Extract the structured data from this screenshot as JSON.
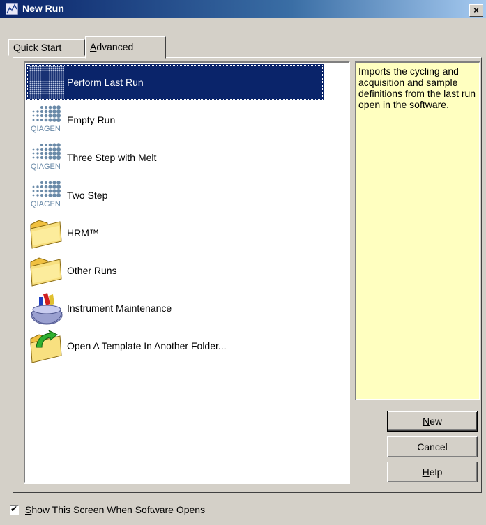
{
  "window": {
    "title": "New Run",
    "close_glyph": "×"
  },
  "tabs": [
    {
      "label": "Quick Start",
      "mnemonic": "Q",
      "rest": "uick Start",
      "active": false
    },
    {
      "label": "Advanced",
      "mnemonic": "A",
      "rest": "dvanced",
      "active": true
    }
  ],
  "list": {
    "items": [
      {
        "label": "Perform Last Run",
        "icon": "qiagen-dots-icon",
        "selected": true
      },
      {
        "label": "Empty Run",
        "icon": "qiagen-logo-icon",
        "selected": false
      },
      {
        "label": "Three Step with Melt",
        "icon": "qiagen-logo-icon",
        "selected": false
      },
      {
        "label": "Two Step",
        "icon": "qiagen-logo-icon",
        "selected": false
      },
      {
        "label": "HRM™",
        "icon": "folder-icon",
        "selected": false
      },
      {
        "label": "Other Runs",
        "icon": "folder-icon",
        "selected": false
      },
      {
        "label": "Instrument Maintenance",
        "icon": "toolbox-icon",
        "selected": false
      },
      {
        "label": "Open A Template In Another Folder...",
        "icon": "folder-open-arrow-icon",
        "selected": false
      }
    ],
    "logo_text": "QIAGEN"
  },
  "description": "Imports the cycling and acquisition and sample definitions from the last run open in the software.",
  "buttons": {
    "new": {
      "mnemonic": "N",
      "rest": "ew"
    },
    "cancel": {
      "label": "Cancel"
    },
    "help": {
      "mnemonic": "H",
      "rest": "elp"
    }
  },
  "footer": {
    "checkbox_checked": true,
    "check_glyph": "✔",
    "label_mnemonic": "S",
    "label_rest": "how This Screen When Software Opens"
  },
  "colors": {
    "selection": "#0a246a",
    "description_bg": "#ffffc0",
    "chrome": "#d4d0c8"
  }
}
